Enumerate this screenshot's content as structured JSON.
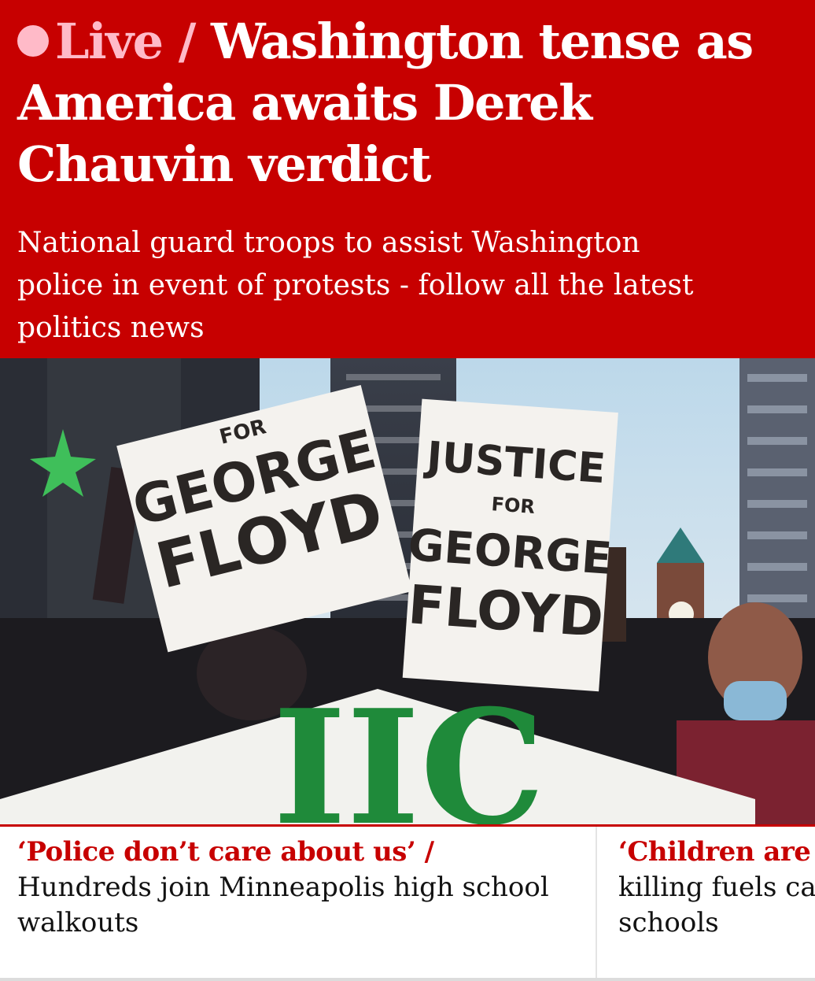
{
  "colors": {
    "brand_red": "#c70000",
    "live_pink": "#ffbac8"
  },
  "hero": {
    "kicker": "Live",
    "separator": " / ",
    "headline": "Washington tense as America awaits Derek Chauvin verdict",
    "standfirst": "National guard troops to assist Washington police in event of protests - follow all the latest politics news"
  },
  "photo": {
    "sign_left_top": "FOR",
    "sign_left_line1": "GEORGE",
    "sign_left_line2": "FLOYD",
    "sign_right_line1": "JUSTICE",
    "sign_right_line2": "FOR",
    "sign_right_line3": "GEORGE",
    "sign_right_line4": "FLOYD",
    "banner_letters": "IIC"
  },
  "cards": [
    {
      "kicker": "‘Police don’t care about us’",
      "separator": " / ",
      "title": "Hundreds join Minneapolis high school walkouts"
    },
    {
      "kicker": "‘Children are d",
      "line2": "killing fuels cal",
      "line3": "schools"
    }
  ]
}
